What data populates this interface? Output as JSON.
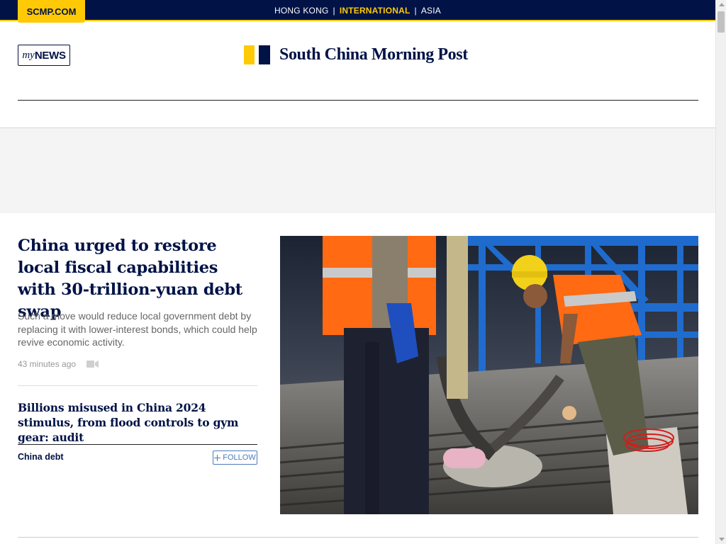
{
  "topbar": {
    "site_link": "SCMP.COM",
    "editions": [
      "HONG KONG",
      "INTERNATIONAL",
      "ASIA"
    ],
    "separator": "|",
    "active_edition": "INTERNATIONAL"
  },
  "header": {
    "mynews_my": "my",
    "mynews_news": "NEWS",
    "logo_text": "South China Morning Post"
  },
  "lead_article": {
    "headline": "China urged to restore local fiscal capabilities with 30-trillion-yuan debt swap",
    "summary": "Such a move would reduce local government debt by replacing it with lower-interest bonds, which could help revive economic activity.",
    "timestamp": "43 minutes ago",
    "media_icon": "video-camera-icon"
  },
  "related_article": {
    "headline": "Billions misused in China 2024 stimulus, from flood controls to gym gear: audit"
  },
  "topic": {
    "label": "China debt",
    "follow_label": "FOLLOW"
  },
  "colors": {
    "navy": "#001246",
    "yellow": "#ffca05",
    "follow_blue": "#4a7bbd"
  }
}
